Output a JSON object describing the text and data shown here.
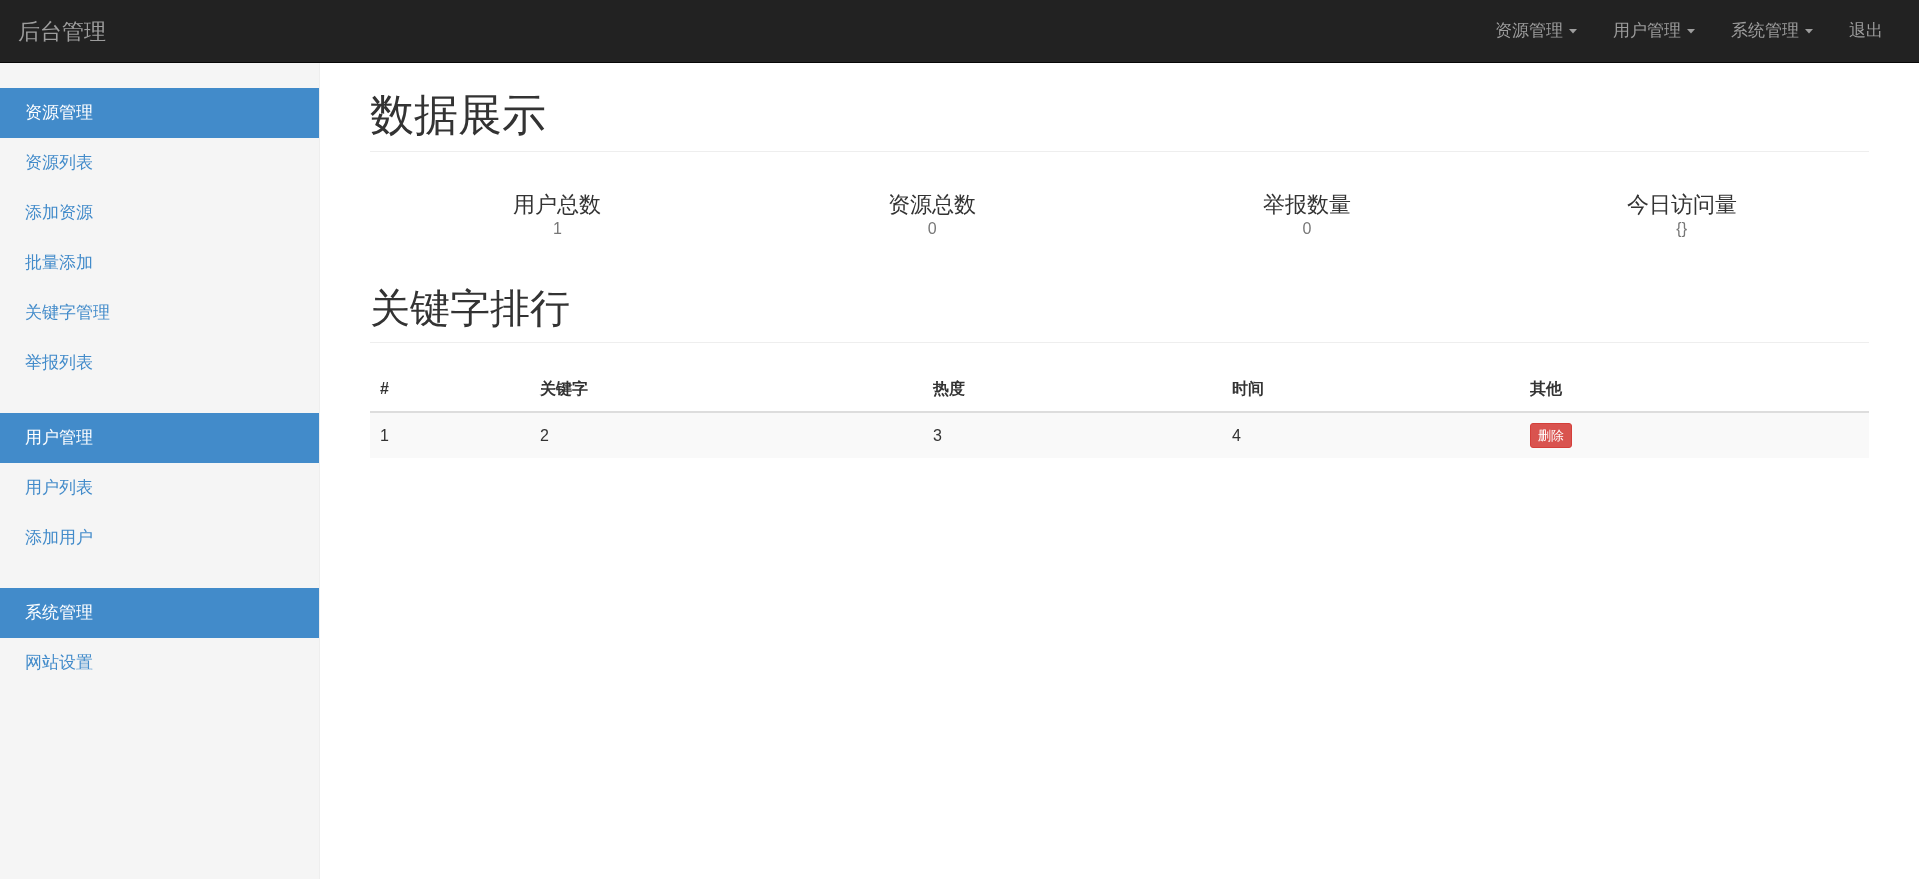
{
  "navbar": {
    "brand": "后台管理",
    "menus": [
      {
        "label": "资源管理",
        "dropdown": true
      },
      {
        "label": "用户管理",
        "dropdown": true
      },
      {
        "label": "系统管理",
        "dropdown": true
      },
      {
        "label": "退出",
        "dropdown": false
      }
    ]
  },
  "sidebar": {
    "groups": [
      {
        "title": "资源管理",
        "items": [
          "资源列表",
          "添加资源",
          "批量添加",
          "关键字管理",
          "举报列表"
        ]
      },
      {
        "title": "用户管理",
        "items": [
          "用户列表",
          "添加用户"
        ]
      },
      {
        "title": "系统管理",
        "items": [
          "网站设置"
        ]
      }
    ]
  },
  "page_title": "数据展示",
  "stats": [
    {
      "label": "用户总数",
      "value": "1"
    },
    {
      "label": "资源总数",
      "value": "0"
    },
    {
      "label": "举报数量",
      "value": "0"
    },
    {
      "label": "今日访问量",
      "value": "{}"
    }
  ],
  "table": {
    "title": "关键字排行",
    "columns": [
      "#",
      "关键字",
      "热度",
      "时间",
      "其他"
    ],
    "rows": [
      {
        "cells": [
          "1",
          "2",
          "3",
          "4"
        ],
        "action": "删除"
      }
    ]
  }
}
